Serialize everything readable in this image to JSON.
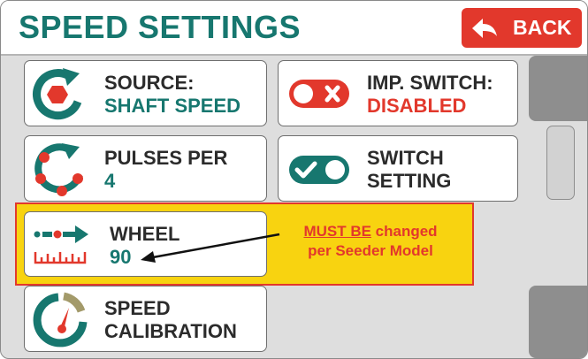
{
  "header": {
    "title": "SPEED SETTINGS",
    "back_label": "BACK"
  },
  "tiles": [
    {
      "line1": "SOURCE:",
      "line2": "SHAFT SPEED",
      "icon": "shaft-speed-icon"
    },
    {
      "line1": "IMP. SWITCH:",
      "line2": "DISABLED",
      "icon": "toggle-off-icon"
    },
    {
      "line1": "PULSES PER",
      "line2": "4",
      "icon": "pulses-icon"
    },
    {
      "line1": "SWITCH",
      "line2": "SETTING",
      "icon": "toggle-on-icon"
    },
    {
      "line1": "WHEEL",
      "line2": "90",
      "icon": "wheel-measure-icon"
    },
    {
      "line1": "SPEED",
      "line2": "CALIBRATION",
      "icon": "gauge-icon"
    }
  ],
  "annotation": {
    "emphasis": "MUST BE",
    "text_1": " changed",
    "text_2": "per Seeder Model"
  },
  "colors": {
    "brand_teal": "#17776f",
    "alert_red": "#e2382c",
    "highlight_yellow": "#f8d310"
  }
}
